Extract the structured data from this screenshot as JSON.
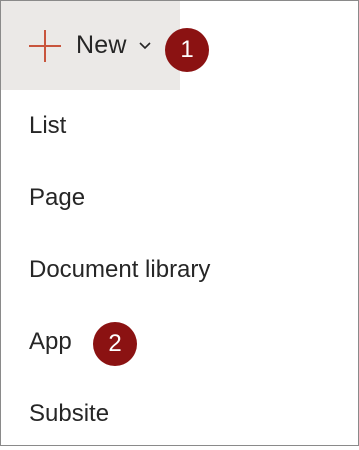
{
  "toolbar": {
    "new_label": "New",
    "plus_icon": "plus-icon",
    "chevron_icon": "chevron-down-icon",
    "accent_color": "#c8553d",
    "button_bg": "#ebe9e7"
  },
  "badges": {
    "first": "1",
    "second": "2",
    "color": "#8b1212"
  },
  "menu": {
    "items": [
      {
        "label": "List"
      },
      {
        "label": "Page"
      },
      {
        "label": "Document library"
      },
      {
        "label": "App"
      },
      {
        "label": "Subsite"
      }
    ]
  }
}
